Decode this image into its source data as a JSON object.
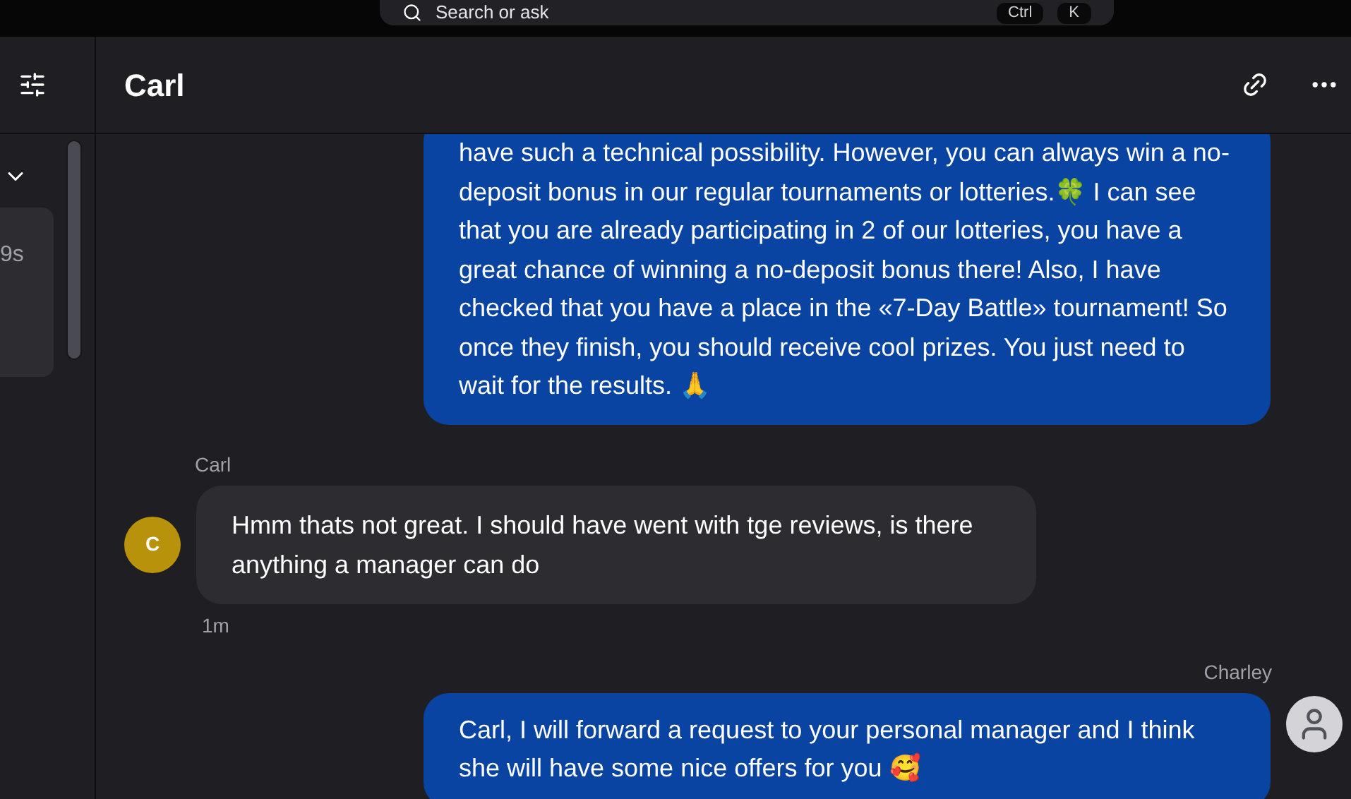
{
  "search": {
    "placeholder": "Search or ask",
    "shortcut": [
      "Ctrl",
      "K"
    ]
  },
  "sidebar": {
    "card_time": "9s"
  },
  "chat": {
    "title": "Carl"
  },
  "messages": [
    {
      "kind": "outgoing",
      "text": "have such a technical possibility. However, you can always win a no-deposit bonus in our regular tournaments or lotteries.🍀 I can see that you are already participating in 2 of our lotteries, you have a great chance of winning a no-deposit bonus there! Also, I have checked that you have a place in the «7-Day Battle» tournament! So once they finish, you should receive cool prizes. You just need to wait for the results. 🙏"
    },
    {
      "kind": "incoming",
      "sender": "Carl",
      "avatar": "C",
      "text": "Hmm thats not great. I should have went with tge reviews, is there anything a manager can do",
      "time": "1m"
    },
    {
      "kind": "outgoing",
      "sender": "Charley",
      "text": "Carl, I will forward a request to your personal manager and I think she will have some nice offers for you 🥰"
    }
  ]
}
